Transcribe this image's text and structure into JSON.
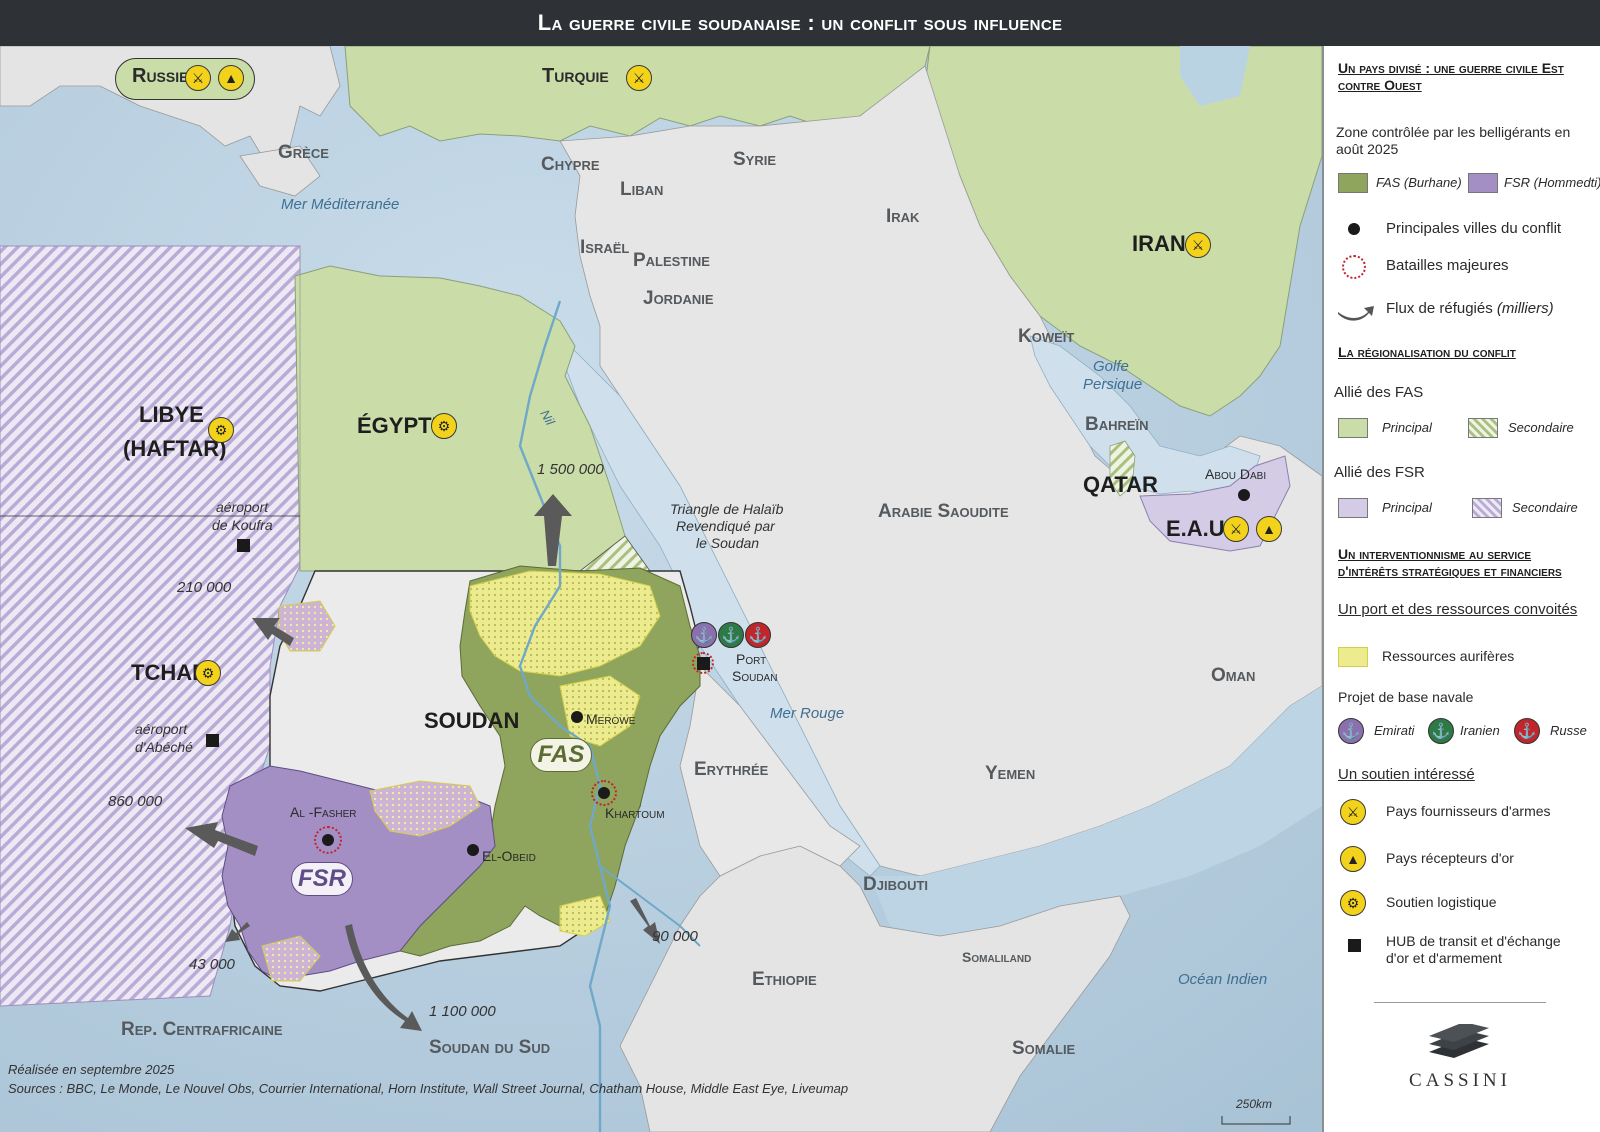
{
  "title": "La guerre civile soudanaise : un conflit sous influence",
  "map": {
    "countries": {
      "russie": "Russie",
      "turquie": "Turquie",
      "grece": "Grèce",
      "chypre": "Chypre",
      "syrie": "Syrie",
      "liban": "Liban",
      "irak": "Irak",
      "iran": "IRAN",
      "israel": "Israël",
      "palestine": "Palestine",
      "jordanie": "Jordanie",
      "koweit": "Koweït",
      "bahrein": "Bahreïn",
      "qatar": "QATAR",
      "eau": "E.A.U",
      "arabie": "Arabie Saoudite",
      "oman": "Oman",
      "yemen": "Yemen",
      "libye_1": "LIBYE",
      "libye_2": "(HAFTAR)",
      "egypte": "ÉGYPTE",
      "tchad": "TCHAD",
      "soudan": "SOUDAN",
      "erythree": "Erythrée",
      "djibouti": "Djibouti",
      "ethiopie": "Ethiopie",
      "somaliland": "Somaliland",
      "somalie": "Somalie",
      "rca": "Rep. Centrafricaine",
      "soudan_sud": "Soudan du Sud"
    },
    "seas": {
      "med": "Mer Méditerranée",
      "golfe_1": "Golfe",
      "golfe_2": "Persique",
      "rouge": "Mer Rouge",
      "indien": "Océan Indien",
      "nil": "Nil"
    },
    "cities": {
      "abou_dabi": "Abou Dabi",
      "port_soudan_1": "Port",
      "port_soudan_2": "Soudan",
      "merowe": "Merowe",
      "khartoum": "Khartoum",
      "el_fasher": "Al -Fasher",
      "el_obeid": "El-Obeid"
    },
    "airports": {
      "koufra_1": "aéroport",
      "koufra_2": "de Koufra",
      "abeche_1": "aéroport",
      "abeche_2": "d'Abéché"
    },
    "halaib": {
      "line1": "Triangle de Halaïb",
      "line2": "Revendiqué par",
      "line3": "le Soudan"
    },
    "zones": {
      "fas": "FAS",
      "fsr": "FSR"
    },
    "refugees": {
      "egypte": "1 500 000",
      "libye": "210 000",
      "tchad": "860 000",
      "rca": "43 000",
      "soudan_sud": "1 100 000",
      "ethiopie": "90 000"
    },
    "footer": {
      "made": "Réalisée en septembre 2025",
      "sources": "Sources : BBC, Le Monde, Le Nouvel Obs, Courrier International, Horn Institute, Wall Street Journal, Chatham House, Middle East Eye, Liveumap"
    },
    "scale": "250km"
  },
  "legend": {
    "section1_title": "Un pays divisé : une guerre civile Est contre Ouest",
    "zone_caption": "Zone contrôlée par les belligérants en août 2025",
    "fas": "FAS (Burhane)",
    "fsr": "FSR (Hommedti)",
    "villes": "Principales villes du conflit",
    "batailles": "Batailles majeures",
    "flux": "Flux de réfugiés",
    "flux_unit": "(milliers)",
    "section2_title": "La régionalisation du conflit",
    "allie_fas": "Allié des FAS",
    "allie_fsr": "Allié des FSR",
    "principal": "Principal",
    "secondaire": "Secondaire",
    "section3_title": "Un interventionnisme au service d'intérêts stratégiques et financiers",
    "port_title": "Un port et des ressources convoités",
    "aurif": "Ressources aurifères",
    "base_navale": "Projet de base navale",
    "emirati": "Emirati",
    "iranien": "Iranien",
    "russe": "Russe",
    "soutien_title": "Un soutien intéressé",
    "armes": "Pays fournisseurs d'armes",
    "or": "Pays récepteurs d'or",
    "logistique": "Soutien logistique",
    "hub": "HUB de transit et d'échange d'or et d'armement",
    "brand": "CASSINI"
  },
  "colors": {
    "sea": "#b9d3e3",
    "land": "#e7e7e7",
    "fas": "#8fa45c",
    "fsr": "#a48fc4",
    "ally_fas": "#cadda8",
    "ally_fsr": "#d4cbe6",
    "gold": "#f0ec8a",
    "badge": "#f2d21b",
    "emirati": "#8a70ad",
    "iranien": "#2e7a46",
    "russe": "#c0262b"
  }
}
